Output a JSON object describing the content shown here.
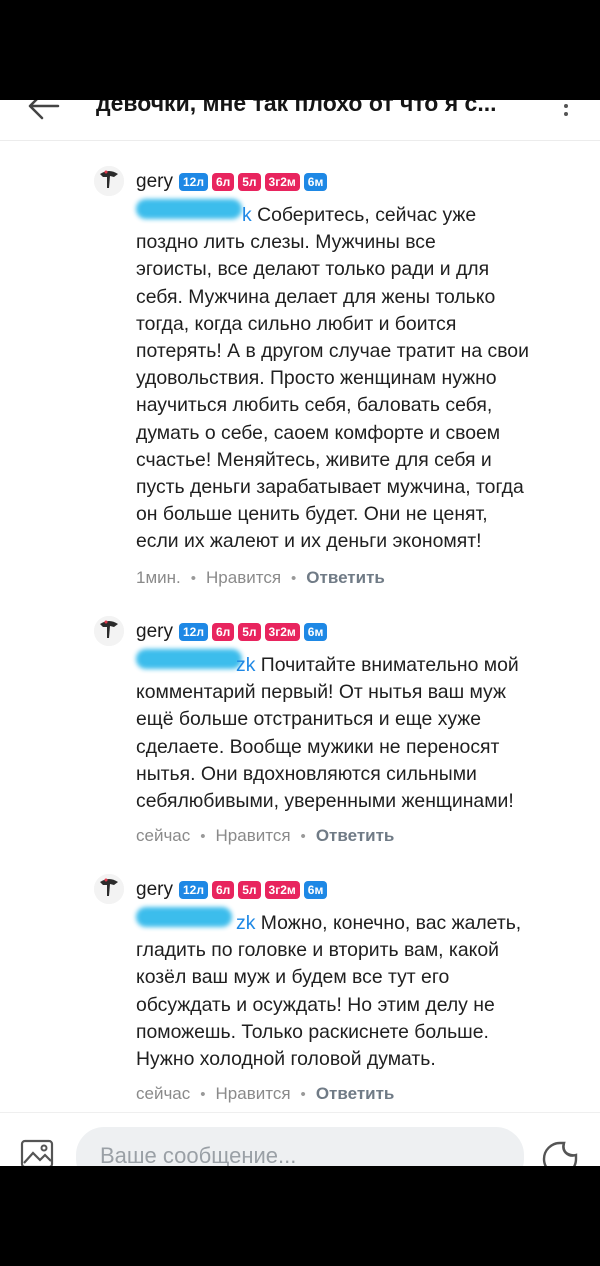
{
  "header": {
    "title": "девочки, мне так плохо от что я с..."
  },
  "comments": [
    {
      "author": "gery",
      "badges": [
        "12л",
        "6л",
        "5л",
        "3г2м",
        "6м"
      ],
      "mention_tail": "k",
      "lines": [
        "Соберитесь, сейчас уже",
        "поздно лить слезы. Мужчины все",
        "эгоисты, все делают только ради и для",
        "себя. Мужчина делает для жены только",
        "тогда, когда сильно любит и боится",
        "потерять! А в другом случае тратит на свои",
        "удовольствия. Просто женщинам нужно",
        "научиться любить себя, баловать себя,",
        "думать о себе, саоем комфорте и своем",
        "счастье! Меняйтесь, живите для себя  и",
        "пусть деньги зарабатывает мужчина, тогда",
        "он больше ценить будет. Они не ценят,",
        "если их жалеют и их деньги экономят!"
      ],
      "time": "1мин.",
      "like": "Нравится",
      "reply": "Ответить"
    },
    {
      "author": "gery",
      "badges": [
        "12л",
        "6л",
        "5л",
        "3г2м",
        "6м"
      ],
      "mention_tail": "zk",
      "lines": [
        "Почитайте внимательно мой",
        "комментарий первый! От нытья ваш муж",
        "ещё больше отстраниться и еще хуже",
        "сделаете. Вообще мужики не переносят",
        "нытья. Они вдохновляются сильными",
        "себялюбивыми, уверенными женщинами!"
      ],
      "time": "сейчас",
      "like": "Нравится",
      "reply": "Ответить"
    },
    {
      "author": "gery",
      "badges": [
        "12л",
        "6л",
        "5л",
        "3г2м",
        "6м"
      ],
      "mention_tail": "zk",
      "lines": [
        "Можно, конечно, вас жалеть,",
        "гладить по головке и вторить вам, какой",
        "козёл ваш муж и будем все тут его",
        "обсуждать и осуждать! Но этим делу не",
        "поможешь. Только раскиснете больше.",
        "Нужно холодной головой думать."
      ],
      "time": "сейчас",
      "like": "Нравится",
      "reply": "Ответить"
    }
  ],
  "composer": {
    "placeholder": "Ваше сообщение..."
  },
  "colors": {
    "badge_blue": "#1e88e5",
    "badge_pink": "#e8245e",
    "mention": "#1e88e5",
    "meta": "#8a8a8a"
  },
  "icons": [
    "back-arrow-icon",
    "more-vertical-icon",
    "avatar-image",
    "image-attach-icon",
    "sticker-icon"
  ]
}
